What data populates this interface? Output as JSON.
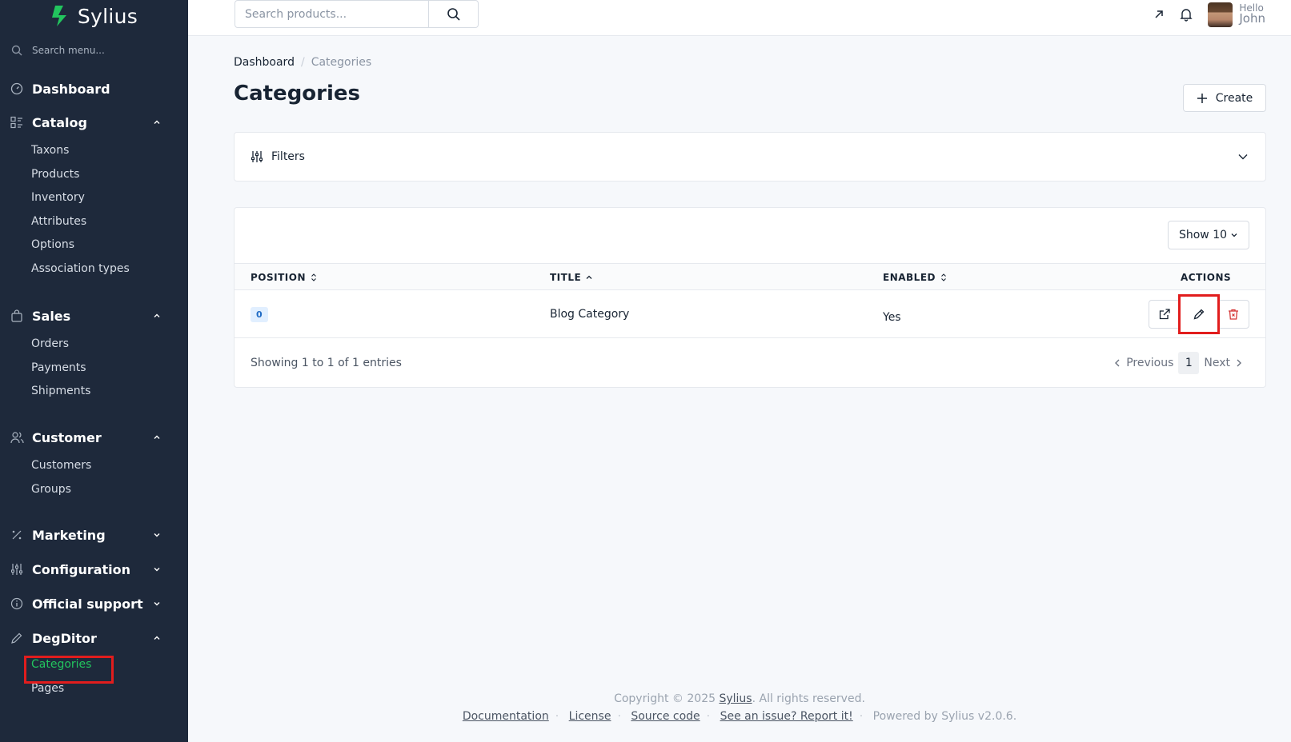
{
  "brand": {
    "name": "Sylius"
  },
  "sidebar": {
    "search_placeholder": "Search menu...",
    "dashboard": "Dashboard",
    "catalog": {
      "label": "Catalog",
      "items": [
        "Taxons",
        "Products",
        "Inventory",
        "Attributes",
        "Options",
        "Association types"
      ]
    },
    "sales": {
      "label": "Sales",
      "items": [
        "Orders",
        "Payments",
        "Shipments"
      ]
    },
    "customer": {
      "label": "Customer",
      "items": [
        "Customers",
        "Groups"
      ]
    },
    "marketing": "Marketing",
    "configuration": "Configuration",
    "official_support": "Official support",
    "degditor": {
      "label": "DegDitor",
      "items": [
        "Categories",
        "Pages"
      ]
    }
  },
  "topbar": {
    "search_placeholder": "Search products...",
    "greeting": "Hello",
    "user": "John"
  },
  "breadcrumb": {
    "home": "Dashboard",
    "separator": "/",
    "current": "Categories"
  },
  "page": {
    "title": "Categories",
    "create": "Create"
  },
  "filters": {
    "label": "Filters"
  },
  "table": {
    "show": "Show 10",
    "headers": {
      "position": "POSITION",
      "title": "TITLE",
      "enabled": "ENABLED",
      "actions": "ACTIONS"
    },
    "rows": [
      {
        "position": "0",
        "title": "Blog Category",
        "enabled": "Yes"
      }
    ],
    "showing": "Showing 1 to 1 of 1 entries",
    "pager": {
      "previous": "Previous",
      "current": "1",
      "next": "Next"
    }
  },
  "footer": {
    "copyright_pre": "Copyright © 2025",
    "copyright_link": "Sylius",
    "copyright_post": ". All rights reserved.",
    "links": [
      "Documentation",
      "License",
      "Source code",
      "See an issue? Report it!"
    ],
    "powered": "Powered by Sylius v2.0.6."
  },
  "colors": {
    "sidebar": "#1e293b",
    "active": "#22c55e",
    "highlight": "#e11d1d",
    "delete": "#d63939"
  }
}
